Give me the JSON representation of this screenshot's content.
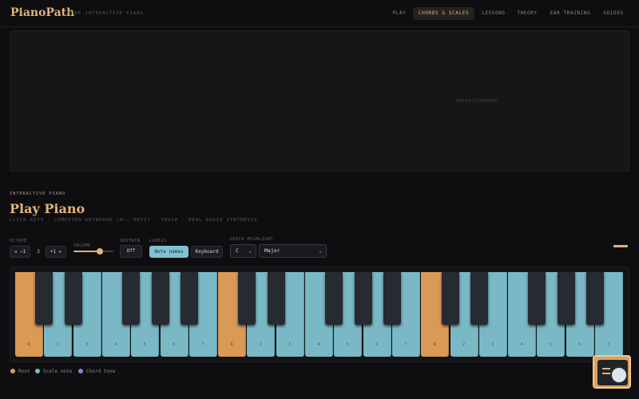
{
  "brand": {
    "name": "PianoPath",
    "tagline": "FREE INTERACTIVE PIANO"
  },
  "nav": {
    "items": [
      "PLAY",
      "CHORDS & SCALES",
      "LESSONS",
      "THEORY",
      "EAR TRAINING",
      "GUIDES"
    ],
    "active_index": 1
  },
  "ad": {
    "label": "ADVERTISEMENT"
  },
  "section": {
    "eyebrow": "INTERACTIVE PIANO",
    "title": "Play Piano",
    "subtitle": "CLICK KEYS · COMPUTER KEYBOARD (A–; KEYS) · TOUCH · REAL AUDIO SYNTHESIS"
  },
  "controls": {
    "octave": {
      "label": "OCTAVE",
      "down": "◂ −1",
      "value": "3",
      "up": "+1 ▸"
    },
    "volume": {
      "label": "VOLUME",
      "level": 0.65
    },
    "sustain": {
      "label": "SUSTAIN",
      "value": "Off"
    },
    "labels": {
      "label": "LABELS",
      "note_names": "Note names",
      "keyboard": "Keyboard",
      "active": "note_names"
    },
    "quick_highlight": {
      "label": "QUICK HIGHLIGHT",
      "root": "C",
      "scale": "Major"
    }
  },
  "keyboard": {
    "white_keys": [
      {
        "label": "R",
        "role": "root"
      },
      {
        "label": "2",
        "role": "scale"
      },
      {
        "label": "3",
        "role": "scale"
      },
      {
        "label": "4",
        "role": "scale"
      },
      {
        "label": "5",
        "role": "scale"
      },
      {
        "label": "6",
        "role": "scale"
      },
      {
        "label": "7",
        "role": "scale"
      },
      {
        "label": "R",
        "role": "root"
      },
      {
        "label": "2",
        "role": "scale"
      },
      {
        "label": "3",
        "role": "scale"
      },
      {
        "label": "4",
        "role": "scale"
      },
      {
        "label": "5",
        "role": "scale"
      },
      {
        "label": "6",
        "role": "scale"
      },
      {
        "label": "7",
        "role": "scale"
      },
      {
        "label": "R",
        "role": "root"
      },
      {
        "label": "2",
        "role": "scale"
      },
      {
        "label": "3",
        "role": "scale"
      },
      {
        "label": "4",
        "role": "scale"
      },
      {
        "label": "5",
        "role": "scale"
      },
      {
        "label": "6",
        "role": "scale"
      },
      {
        "label": "7",
        "role": "scale"
      }
    ]
  },
  "legend": [
    {
      "label": "Root",
      "color": "#d99a56"
    },
    {
      "label": "Scale note",
      "color": "#7ab8c6"
    },
    {
      "label": "Chord tone",
      "color": "#9a78d6"
    }
  ],
  "colors": {
    "accent": "#e2b37a",
    "scale": "#7ab8c6",
    "root": "#d99a56",
    "chord": "#9a78d6"
  }
}
